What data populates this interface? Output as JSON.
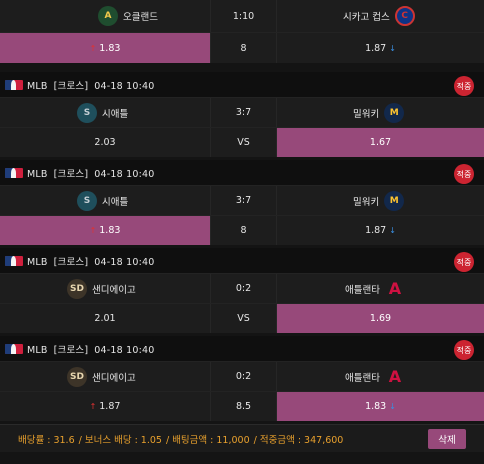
{
  "colors": {
    "selected": "#97497a",
    "hit_badge": "#cc2431",
    "footer_text": "#e8a02d",
    "up": "#e03232",
    "down": "#3a8fe0"
  },
  "top_partial": {
    "home_team": "오클랜드",
    "home_logo_icon": "athletics-icon",
    "score": "1:10",
    "away_team": "시카고 컵스",
    "away_logo_icon": "cubs-icon",
    "home_odds": "1.83",
    "line": "8",
    "away_odds": "1.87",
    "home_arrow": "↑",
    "away_arrow": "↓"
  },
  "bets": [
    {
      "league": "MLB",
      "type": "[크로스]",
      "datetime": "04-18 10:40",
      "hit": "적중",
      "home_team": "시애틀",
      "home_logo_icon": "mariners-icon",
      "score": "3:7",
      "away_team": "밀워키",
      "away_logo_icon": "brewers-icon",
      "home_odds": "2.03",
      "line": "VS",
      "away_odds": "1.67",
      "home_arrow": "",
      "away_arrow": "",
      "selected": "away"
    },
    {
      "league": "MLB",
      "type": "[크로스]",
      "datetime": "04-18 10:40",
      "hit": "적중",
      "home_team": "시애틀",
      "home_logo_icon": "mariners-icon",
      "score": "3:7",
      "away_team": "밀워키",
      "away_logo_icon": "brewers-icon",
      "home_odds": "1.83",
      "line": "8",
      "away_odds": "1.87",
      "home_arrow": "↑",
      "away_arrow": "↓",
      "selected": "home"
    },
    {
      "league": "MLB",
      "type": "[크로스]",
      "datetime": "04-18 10:40",
      "hit": "적중",
      "home_team": "샌디에이고",
      "home_logo_icon": "padres-icon",
      "score": "0:2",
      "away_team": "애틀랜타",
      "away_logo_icon": "braves-icon",
      "home_odds": "2.01",
      "line": "VS",
      "away_odds": "1.69",
      "home_arrow": "",
      "away_arrow": "",
      "selected": "away"
    },
    {
      "league": "MLB",
      "type": "[크로스]",
      "datetime": "04-18 10:40",
      "hit": "적중",
      "home_team": "샌디에이고",
      "home_logo_icon": "padres-icon",
      "score": "0:2",
      "away_team": "애틀랜타",
      "away_logo_icon": "braves-icon",
      "home_odds": "1.87",
      "line": "8.5",
      "away_odds": "1.83",
      "home_arrow": "↑",
      "away_arrow": "↓",
      "selected": "away"
    }
  ],
  "footer": {
    "rate": "배당률 : 31.6",
    "bonus": "/ 보너스 배당 : 1.05",
    "amount": "/ 배팅금액 : 11,000",
    "win_amount": "/ 적중금액 : 347,600",
    "delete_label": "삭제"
  }
}
